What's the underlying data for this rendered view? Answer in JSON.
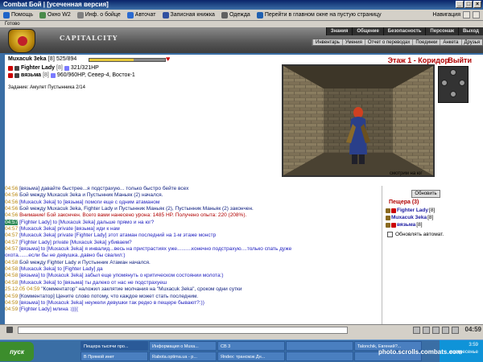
{
  "window": {
    "title": "Combat Бой | [усеченная версия]"
  },
  "toolbar": {
    "items": [
      {
        "label": "Помощь",
        "icon": "help-icon",
        "color": "#1e64c8"
      },
      {
        "label": "Окно W2",
        "icon": "window-icon",
        "color": "#4a8a4a"
      },
      {
        "label": "Инф. о бойце",
        "icon": "info-icon",
        "color": "#808080"
      },
      {
        "label": "Авточат",
        "icon": "chat-icon",
        "color": "#2a6ad0"
      },
      {
        "label": "Записная книжка",
        "icon": "notebook-icon",
        "color": "#3050a0"
      },
      {
        "label": "Одежда",
        "icon": "clothes-icon",
        "color": "#606060"
      },
      {
        "label": "Перейти в главном окне на пустую страницу",
        "icon": "page-icon",
        "color": "#2060b0"
      }
    ],
    "nav_label": "Навигация"
  },
  "address": {
    "status": "Готово"
  },
  "header": {
    "site_name": "CAPITALCITY",
    "top_menu": [
      "Знания",
      "Общение",
      "Безопасность",
      "Персонаж",
      "Выход"
    ],
    "sub_menu": [
      "Инвентарь",
      "Умения",
      "Отчет о переводах",
      "Поединки",
      "Анкета",
      "Друзья"
    ]
  },
  "player": {
    "name": "Muxacuk 3eka",
    "level": "[8]",
    "hp": "525/894",
    "hp_fraction": 0.59,
    "enemy_1": "Fighter Lady",
    "enemy_1_level": "[8]",
    "enemy_1_hp": "321/321HP",
    "enemy_2": "вязьма",
    "enemy_2_level": "[8]",
    "enemy_2_info": "960/960HP, Север-4, Восток-1",
    "task": "Задание: Амулет Пустынника 2/14"
  },
  "location": {
    "title": "Этаж 1 - Коридор",
    "exit": "Выйти",
    "caption": "смотрим на юг"
  },
  "chat": [
    {
      "time": "04:56",
      "text": "[вязьма] давайте быстрее...я подстрахую... только быстро бейте всех",
      "style": "navy"
    },
    {
      "time": "04:56",
      "text": "Бой между Muxacuk 3eka и Пустынник Маньяк (2) начался.",
      "style": "navy"
    },
    {
      "time": "04:56",
      "text": "[Muxacuk 3eka] to [вязьма] помоги еще с одним атаманом",
      "style": "blue"
    },
    {
      "time": "04:56",
      "text": "Бой между Muxacuk 3eka, Fighter Lady и Пустынник Маньяк (2), Пустынник Маньяк (2) закончен.",
      "style": "navy"
    },
    {
      "time": "04:56",
      "text": "Внимание! Бой закончен. Всего вами нанесено урона: 1485 HP. Получено опыта: 220 (208%).",
      "style": "red"
    },
    {
      "time": "04:57",
      "text": "[Fighter Lady] to [Muxacuk 3eka] дальше прямо и на юг?",
      "style": "blue",
      "hi": true
    },
    {
      "time": "04:57",
      "text": "[Muxacuk 3eka] private [вязьма] иди к нам",
      "style": "blue"
    },
    {
      "time": "04:57",
      "text": "[Muxacuk 3eka] private [Fighter Lady] этот атаман последний на 1-м этаже монстр",
      "style": "blue"
    },
    {
      "time": "04:57",
      "text": "[Fighter Lady] private [Muxacuk 3eka] убиваем?",
      "style": "blue"
    },
    {
      "time": "04:57",
      "text": "[вязьма] to [Muxacuk 3eka] я инвалид...весь на пристрастиях уже..........конечно подстрахую....только спать дуже",
      "style": "blue"
    },
    {
      "time": "",
      "text": "охота.......если бы не девушка..давно бы свалил:)",
      "style": "blue"
    },
    {
      "time": "04:58",
      "text": "Бой между Fighter Lady и Пустынник Атаман начался.",
      "style": "navy"
    },
    {
      "time": "04:58",
      "text": "[Muxacuk 3eka] to [Fighter Lady] да",
      "style": "blue"
    },
    {
      "time": "04:58",
      "text": "[вязьма] to [Muxacuk 3eka] забыл еще упомянуть о критическом состоянии молота:)",
      "style": "blue"
    },
    {
      "time": "04:58",
      "text": "[Muxacuk 3eka] to [вязьма] ты далеко от нас не подстрахуеш",
      "style": "blue"
    },
    {
      "time": "",
      "text": "",
      "style": "navy"
    },
    {
      "time": "25.12.05 04:59",
      "text": "\"Комментатор\" наложил заклятие молчания на \"Muxacuk 3eka\", сроком одни сутки",
      "style": "navy"
    },
    {
      "time": "04:59",
      "text": "[Комментатор] Цените слово потому, что каждое может стать последним.",
      "style": "navy"
    },
    {
      "time": "04:59",
      "text": "[вязьма] to [Muxacuk 3eka] неужели девушки так редко в пещере бывают?:))",
      "style": "blue"
    },
    {
      "time": "04:59",
      "text": "[Fighter Lady] млина :((((",
      "style": "blue"
    }
  ],
  "side": {
    "refresh_label": "Обновить",
    "cave_title": "Пещера (3)",
    "members": [
      {
        "name": "Fighter Lady",
        "level": "[8]"
      },
      {
        "name": "Muxacuk 3eka",
        "level": "[8]"
      },
      {
        "name": "вязьма",
        "level": "[8]"
      }
    ],
    "auto_refresh_label": "Обновлять автомат."
  },
  "inputbar": {
    "clock": "04:59"
  },
  "taskbar": {
    "start_label": "пуск",
    "tasks": [
      "Пещера тысячи про...",
      "Информация о Muxa...",
      "СВ 3",
      "",
      "Talonchik, Евгений?...",
      "В Прямой инет",
      "Rabota.optima.ua - р...",
      "Яndex: трансмэк Дн...",
      "",
      ""
    ],
    "tray_time": "3:59",
    "tray_day": "воскресенье"
  },
  "watermark": "photo.scrolls.combats.com",
  "colors": {
    "accent_red": "#b00000",
    "chat_blue": "#2020c0",
    "header_gray": "#555555",
    "taskbar_blue": "#3a6ea5"
  }
}
